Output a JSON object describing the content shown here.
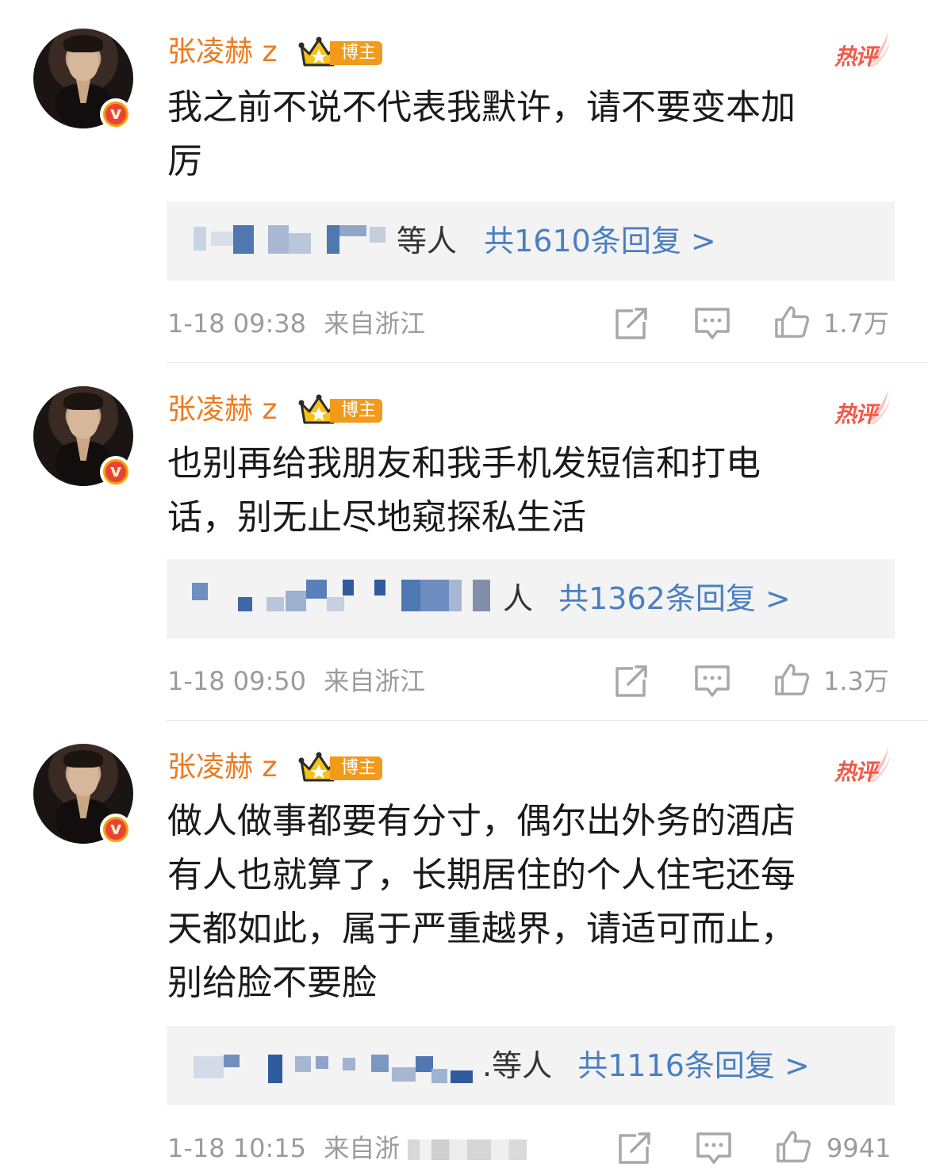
{
  "comments": [
    {
      "username": "张凌赫 z",
      "badge_label": "博主",
      "hot_label": "热评",
      "text_lines": [
        "我之前不说不代表我默许，请不要变本加",
        "厉"
      ],
      "reply_suffix": "等人",
      "reply_count": "共1610条回复 >",
      "time": "1-18 09:38",
      "location": "来自浙江",
      "likes": "1.7万"
    },
    {
      "username": "张凌赫 z",
      "badge_label": "博主",
      "hot_label": "热评",
      "text_lines": [
        "也别再给我朋友和我手机发短信和打电",
        "话，别无止尽地窥探私生活"
      ],
      "reply_suffix": "人",
      "reply_count": "共1362条回复 >",
      "time": "1-18 09:50",
      "location": "来自浙江",
      "likes": "1.3万"
    },
    {
      "username": "张凌赫 z",
      "badge_label": "博主",
      "hot_label": "热评",
      "text_lines": [
        "做人做事都要有分寸，偶尔出外务的酒店",
        "有人也就算了，长期居住的个人住宅还每",
        "天都如此，属于严重越界，请适可而止，",
        "别给脸不要脸"
      ],
      "reply_suffix": ".等人",
      "reply_count": "共1116条回复 >",
      "time": "1-18 10:15",
      "location": "来自浙",
      "likes": "9941"
    }
  ],
  "icons": {
    "verified": "verified-v-icon",
    "crown": "crown-icon",
    "share": "share-icon",
    "comment": "comment-icon",
    "like": "thumbs-up-icon"
  },
  "colors": {
    "username": "#ee7a1e",
    "link": "#4a7fc2",
    "hot": "#f05a4a",
    "meta": "#9b9b9b"
  }
}
